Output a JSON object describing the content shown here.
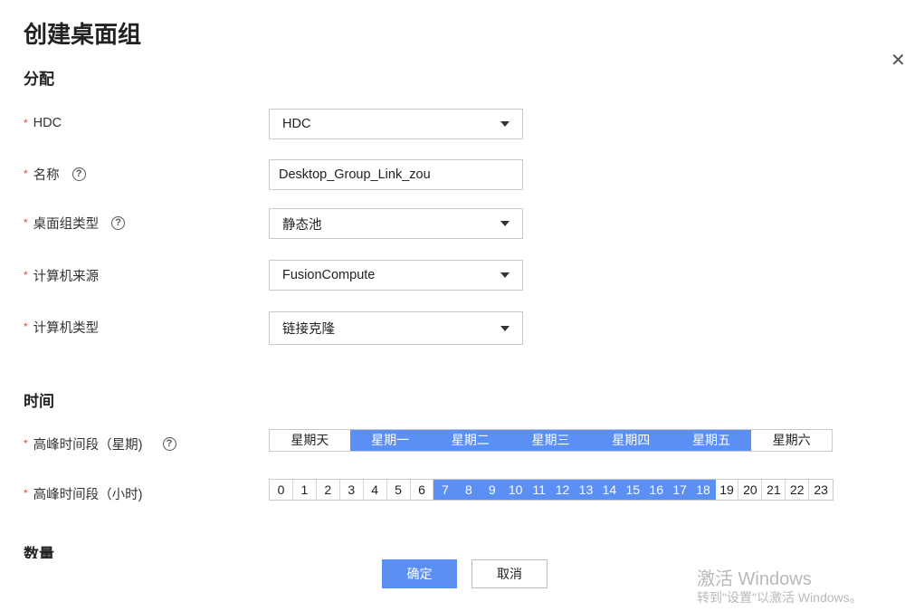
{
  "dialog": {
    "title": "创建桌面组",
    "close_icon": "close-icon"
  },
  "sections": {
    "allocation": "分配",
    "time": "时间",
    "quantity": "数量"
  },
  "fields": {
    "hdc": {
      "label": "HDC",
      "value": "HDC"
    },
    "name": {
      "label": "名称",
      "value": "Desktop_Group_Link_zou"
    },
    "group_type": {
      "label": "桌面组类型",
      "value": "静态池"
    },
    "machine_source": {
      "label": "计算机来源",
      "value": "FusionCompute"
    },
    "machine_type": {
      "label": "计算机类型",
      "value": "链接克隆"
    }
  },
  "help_glyph": "?",
  "required_mark": "*",
  "peak_days": {
    "label": "高峰时间段（星期)",
    "days": [
      "星期天",
      "星期一",
      "星期二",
      "星期三",
      "星期四",
      "星期五",
      "星期六"
    ],
    "selected": [
      false,
      true,
      true,
      true,
      true,
      true,
      false
    ]
  },
  "peak_hours": {
    "label": "高峰时间段（小时)",
    "hours": [
      "0",
      "1",
      "2",
      "3",
      "4",
      "5",
      "6",
      "7",
      "8",
      "9",
      "10",
      "11",
      "12",
      "13",
      "14",
      "15",
      "16",
      "17",
      "18",
      "19",
      "20",
      "21",
      "22",
      "23"
    ],
    "selected_from": 7,
    "selected_to": 18
  },
  "buttons": {
    "confirm": "确定",
    "cancel": "取消"
  },
  "watermark": {
    "line1": "激活 Windows",
    "line2": "转到\"设置\"以激活 Windows。"
  },
  "colors": {
    "accent": "#5b8ff4",
    "required": "#e04848"
  }
}
